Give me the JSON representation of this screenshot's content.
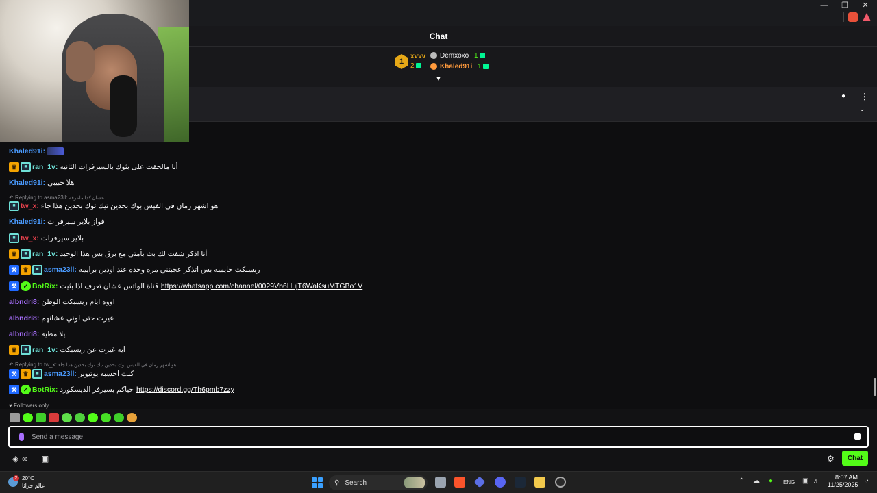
{
  "header": {
    "title": "Chat"
  },
  "leaderboard": {
    "rank": "1",
    "top_user": "xvvv",
    "top_count": "2",
    "entries": [
      {
        "name": "Demxoxo",
        "count": "1",
        "color": "#efeff1"
      },
      {
        "name": "Khaled91i",
        "count": "1",
        "color": "#ff9a3c"
      }
    ]
  },
  "colors": {
    "accent": "#53fc18",
    "blue_user": "#4a9bff",
    "red_user": "#e8414c",
    "purple_user": "#a970ff",
    "teal_user": "#6fe1d8"
  },
  "messages": [
    {
      "user": "Khaled91i",
      "text": "",
      "emoji": "emote-image"
    },
    {
      "user": "ran_1v",
      "text": "أنا مالحقت على بثوك بالسيرفرات الثانيه"
    },
    {
      "user": "Khaled91i",
      "text": "هلا حبيبي"
    },
    {
      "reply_label": "Replying to asma23ll:",
      "reply_text": "عشان كذا ماعرفه"
    },
    {
      "user": "tw_x",
      "text": "هو اشهر زمان في الفيس بوك بحدين تيك توك بحدين هذا جاء"
    },
    {
      "user": "Khaled91i",
      "text": "فواز بلاير سيرفرات"
    },
    {
      "user": "tw_x",
      "text": "بلاير سيرفرات"
    },
    {
      "user": "ran_1v",
      "text": "أنا اذكر شفت لك بث بأمتي مع برق بس هذا الوحيد"
    },
    {
      "user": "asma23ll",
      "text": "ريسبكت خايسه بس اتذكر عجبتني مره وحده عند اودين برايمه"
    },
    {
      "user": "BotRix",
      "text": "قناة الواتس عشان تعرف اذا بثيت",
      "link": "https://whatsapp.com/channel/0029Vb6HujT6WaKsuMTGBo1V"
    },
    {
      "user": "albndri8",
      "text": "اووه ايام ريسبكت الوطن"
    },
    {
      "user": "albndri8",
      "text": "غيرت حتى لوني عشانهم"
    },
    {
      "user": "albndri8",
      "text": "يلا مطيه"
    },
    {
      "user": "ran_1v",
      "text": "ايه غيرت عن ريسبكت"
    },
    {
      "reply_label": "Replying to tw_x:",
      "reply_text": "هو اشهر زمان في الفيس بوك بحدين تيك توك بحدين هذا جاء"
    },
    {
      "user": "asma23ll",
      "text": "كنت احسبه يوتيوبر"
    },
    {
      "user": "BotRix",
      "text": "حياكم بسيرفر الديسكورد",
      "link": "https://discord.gg/Th6pmb7zzy"
    }
  ],
  "followers_only": "Followers only",
  "input": {
    "placeholder": "Send a message"
  },
  "chat_button": "Chat",
  "taskbar": {
    "temperature": "20°C",
    "weather_label": "عالم جزائا",
    "weather_badge": "2",
    "search_label": "Search",
    "language": "ENG",
    "time": "8:07 AM",
    "date": "11/25/2025"
  }
}
